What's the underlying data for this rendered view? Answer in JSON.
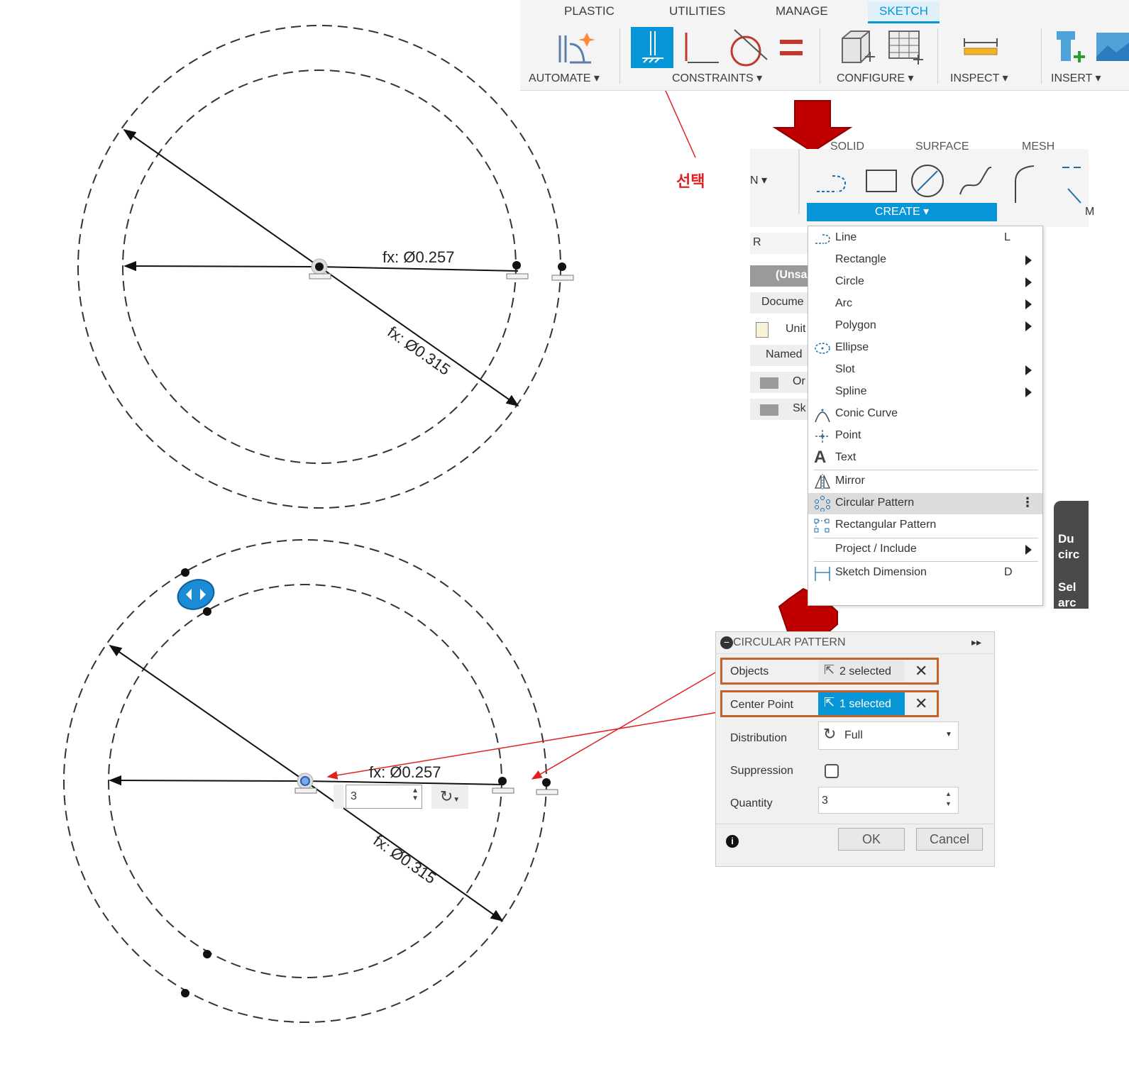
{
  "ribbon": {
    "tabs": [
      "PLASTIC",
      "UTILITIES",
      "MANAGE",
      "SKETCH"
    ],
    "active_tab": "SKETCH",
    "groups": [
      "AUTOMATE ▾",
      "CONSTRAINTS ▾",
      "CONFIGURE ▾",
      "INSPECT ▾",
      "INSERT ▾"
    ]
  },
  "annotation": {
    "select_label": "선택"
  },
  "create_panel": {
    "tab_fragments": [
      "SOLID",
      "SURFACE",
      "MESH"
    ],
    "dropdown_label": "CREATE ▾",
    "left_fragment": "N ▾",
    "right_fragment": "M"
  },
  "browser_fragments": [
    "R",
    "(Unsa",
    "Docume",
    "Unit",
    "Named",
    "Or",
    "Sk"
  ],
  "create_menu": {
    "items": [
      {
        "label": "Line",
        "shortcut": "L"
      },
      {
        "label": "Rectangle"
      },
      {
        "label": "Circle"
      },
      {
        "label": "Arc"
      },
      {
        "label": "Polygon"
      },
      {
        "label": "Ellipse"
      },
      {
        "label": "Slot"
      },
      {
        "label": "Spline"
      },
      {
        "label": "Conic Curve"
      },
      {
        "label": "Point"
      },
      {
        "label": "Text"
      },
      {
        "label": "Mirror"
      },
      {
        "label": "Circular Pattern"
      },
      {
        "label": "Rectangular Pattern"
      },
      {
        "label": "Project / Include"
      },
      {
        "label": "Sketch Dimension",
        "shortcut": "D"
      }
    ],
    "highlighted": "Circular Pattern"
  },
  "tooltip_fragments": [
    "Du",
    "circ",
    "Sel",
    "arc"
  ],
  "sketch_top": {
    "dim_inner": "fx: Ø0.257",
    "dim_outer": "fx: Ø0.315"
  },
  "sketch_bottom": {
    "dim_inner": "fx: Ø0.257",
    "dim_outer": "fx: Ø0.315",
    "quantity_inline": "3"
  },
  "dialog": {
    "title": "CIRCULAR PATTERN",
    "objects_label": "Objects",
    "objects_value": "2 selected",
    "center_label": "Center Point",
    "center_value": "1 selected",
    "distribution_label": "Distribution",
    "distribution_value": "Full",
    "suppression_label": "Suppression",
    "quantity_label": "Quantity",
    "quantity_value": "3",
    "ok_label": "OK",
    "cancel_label": "Cancel"
  },
  "colors": {
    "accent_blue": "#0696d7",
    "arrow_red": "#c00000",
    "highlight_orange": "#c5622a",
    "leader_red": "#e02020"
  }
}
